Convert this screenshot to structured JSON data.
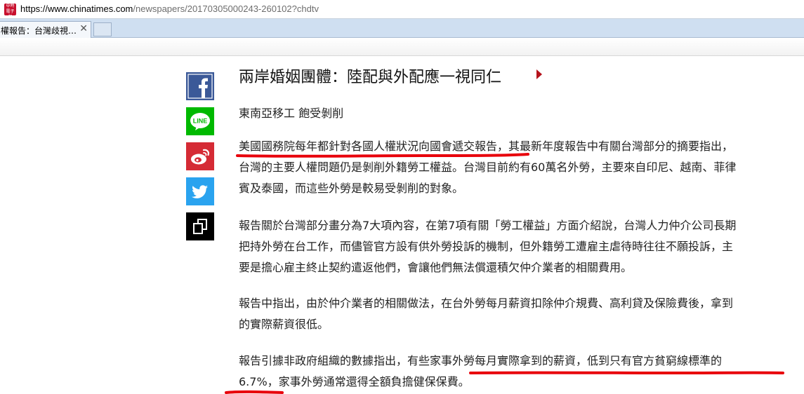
{
  "browser": {
    "url_scheme": "https://www.",
    "url_host": "chinatimes.com",
    "url_path": "/newspapers/20170305000243-260102?chdtv",
    "favicon_text": "中時電子報",
    "tab_title": "權報告：台灣歧視…",
    "tab_close": "✕"
  },
  "share": {
    "facebook_icon": "facebook-icon",
    "line_label": "LINE",
    "weibo_icon": "weibo-icon",
    "twitter_icon": "twitter-icon",
    "copy_icon": "copy-icon"
  },
  "article": {
    "headline": "兩岸婚姻團體：陸配與外配應一視同仁",
    "subtitle": "東南亞移工 飽受剝削",
    "paragraphs": [
      [
        "美國國務院每年都針對各國人權狀況向國會遞交報告，其最新年度報告中有關台灣部分的摘要指出，",
        "台灣的主要人權問題仍是剝削外籍勞工權益。台灣目前約有60萬名外勞，主要來自印尼、越南、菲律",
        "賓及泰國，而這些外勞是較易受剝削的對象。"
      ],
      [
        "報告關於台灣部分畫分為7大項內容，在第7項有關「勞工權益」方面介紹說，台灣人力仲介公司長期",
        "把持外勞在台工作，而儘管官方設有供外勞投訴的機制，但外籍勞工遭雇主虐待時往往不願投訴，主",
        "要是擔心雇主終止契約遣返他們，會讓他們無法償還積欠仲介業者的相關費用。"
      ],
      [
        "報告中指出，由於仲介業者的相關做法，在台外勞每月薪資扣除仲介規費、高利貸及保險費後，拿到",
        "的實際薪資很低。"
      ],
      [
        "報告引據非政府組織的數據指出，有些家事外勞每月實際拿到的薪資，低到只有官方貧窮線標準的",
        "6.7%，家事外勞通常還得全額負擔健保保費。"
      ]
    ]
  },
  "colors": {
    "facebook": "#3b5998",
    "line": "#00b900",
    "weibo": "#d52b35",
    "twitter": "#2aa3ef",
    "annotation": "#e8000b",
    "headline_arrow": "#b5121b"
  }
}
